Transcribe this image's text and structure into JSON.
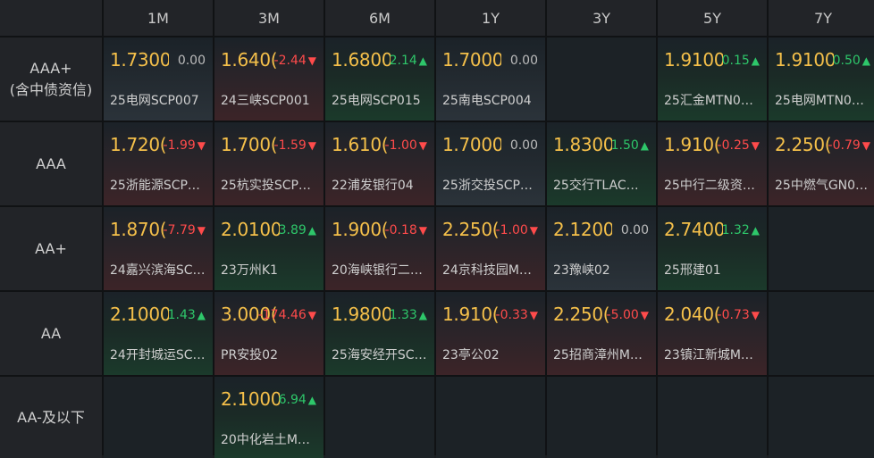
{
  "columns": [
    "1M",
    "3M",
    "6M",
    "1Y",
    "3Y",
    "5Y",
    "7Y"
  ],
  "rows": [
    {
      "label": "AAA+\n(含中债资信)",
      "cells": [
        {
          "yield": "1.7300",
          "change": "0.00",
          "dir": "flat",
          "name": "25电网SCP007"
        },
        {
          "yield": "1.640(",
          "change": "-2.44",
          "dir": "down",
          "name": "24三峡SCP001"
        },
        {
          "yield": "1.6800",
          "change": "2.14",
          "dir": "up",
          "name": "25电网SCP015"
        },
        {
          "yield": "1.7000",
          "change": "0.00",
          "dir": "flat",
          "name": "25南电SCP004"
        },
        null,
        {
          "yield": "1.9100",
          "change": "0.15",
          "dir": "up",
          "name": "25汇金MTN0…"
        },
        {
          "yield": "1.9100",
          "change": "0.50",
          "dir": "up",
          "name": "25电网MTN0…"
        }
      ]
    },
    {
      "label": "AAA",
      "cells": [
        {
          "yield": "1.720(",
          "change": "-1.99",
          "dir": "down",
          "name": "25浙能源SCP…"
        },
        {
          "yield": "1.700(",
          "change": "-1.59",
          "dir": "down",
          "name": "25杭实投SCP…"
        },
        {
          "yield": "1.610(",
          "change": "-1.00",
          "dir": "down",
          "name": "22浦发银行04"
        },
        {
          "yield": "1.7000",
          "change": "0.00",
          "dir": "flat",
          "name": "25浙交投SCP…"
        },
        {
          "yield": "1.8300",
          "change": "1.50",
          "dir": "up",
          "name": "25交行TLAC…"
        },
        {
          "yield": "1.910(",
          "change": "-0.25",
          "dir": "down",
          "name": "25中行二级资…"
        },
        {
          "yield": "2.250(",
          "change": "-0.79",
          "dir": "down",
          "name": "25中燃气GN0…"
        }
      ]
    },
    {
      "label": "AA+",
      "cells": [
        {
          "yield": "1.870(",
          "change": "-7.79",
          "dir": "down",
          "name": "24嘉兴滨海SC…"
        },
        {
          "yield": "2.0100",
          "change": "3.89",
          "dir": "up",
          "name": "23万州K1"
        },
        {
          "yield": "1.900(",
          "change": "-0.18",
          "dir": "down",
          "name": "20海峡银行二…"
        },
        {
          "yield": "2.250(",
          "change": "-1.00",
          "dir": "down",
          "name": "24京科技园M…"
        },
        {
          "yield": "2.1200",
          "change": "0.00",
          "dir": "flat",
          "name": "23豫峡02"
        },
        {
          "yield": "2.7400",
          "change": "1.32",
          "dir": "up",
          "name": "25邢建01"
        },
        null
      ]
    },
    {
      "label": "AA",
      "cells": [
        {
          "yield": "2.1000",
          "change": "1.43",
          "dir": "up",
          "name": "24开封城运SC…"
        },
        {
          "yield": "3.000(",
          "change": "-174.46",
          "dir": "down",
          "name": "PR安投02"
        },
        {
          "yield": "1.9800",
          "change": "1.33",
          "dir": "up",
          "name": "25海安经开SC…"
        },
        {
          "yield": "1.910(",
          "change": "-0.33",
          "dir": "down",
          "name": "23亭公02"
        },
        {
          "yield": "2.250(",
          "change": "-5.00",
          "dir": "down",
          "name": "25招商漳州M…"
        },
        {
          "yield": "2.040(",
          "change": "-0.73",
          "dir": "down",
          "name": "23镇江新城M…"
        },
        null
      ]
    },
    {
      "label": "AA-及以下",
      "cells": [
        null,
        {
          "yield": "2.1000",
          "change": "6.94",
          "dir": "up",
          "name": "20中化岩土M…"
        },
        null,
        null,
        null,
        null,
        null
      ]
    }
  ],
  "arrows": {
    "up": "▲",
    "down": "▼",
    "flat": ""
  },
  "colors": {
    "yield": "#f5c04a",
    "up": "#2ec76a",
    "down": "#ff4b4b",
    "flat": "#bcbcbc"
  }
}
